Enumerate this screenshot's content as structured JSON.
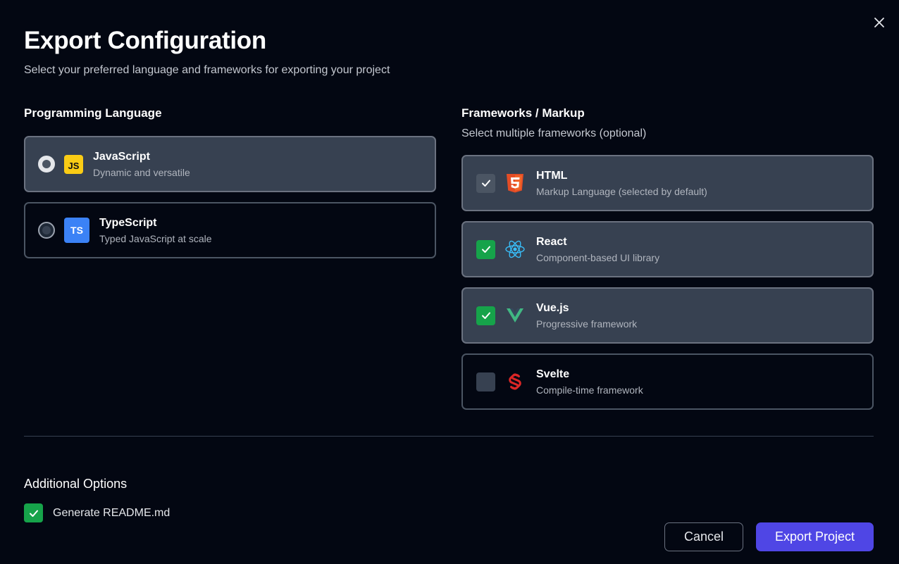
{
  "dialog": {
    "title": "Export Configuration",
    "subtitle": "Select your preferred language and frameworks for exporting your project"
  },
  "language_section": {
    "heading": "Programming Language",
    "options": [
      {
        "name": "JavaScript",
        "description": "Dynamic and versatile",
        "badge": "JS",
        "selected": true
      },
      {
        "name": "TypeScript",
        "description": "Typed JavaScript at scale",
        "badge": "TS",
        "selected": false
      }
    ]
  },
  "frameworks_section": {
    "heading": "Frameworks / Markup",
    "subheading": "Select multiple frameworks (optional)",
    "options": [
      {
        "name": "HTML",
        "description": "Markup Language (selected by default)",
        "icon": "html5-icon",
        "checked": true
      },
      {
        "name": "React",
        "description": "Component-based UI library",
        "icon": "react-icon",
        "checked": true
      },
      {
        "name": "Vue.js",
        "description": "Progressive framework",
        "icon": "vue-icon",
        "checked": true
      },
      {
        "name": "Svelte",
        "description": "Compile-time framework",
        "icon": "svelte-icon",
        "checked": false
      }
    ]
  },
  "additional_options": {
    "heading": "Additional Options",
    "items": [
      {
        "label": "Generate README.md",
        "checked": true
      }
    ]
  },
  "actions": {
    "cancel_label": "Cancel",
    "export_label": "Export Project"
  },
  "colors": {
    "background": "#030712",
    "accent": "#4f46e5",
    "check_green": "#16a34a",
    "js_yellow": "#facc15",
    "ts_blue": "#3b82f6",
    "html_orange": "#e44d26",
    "react_blue": "#38bdf8",
    "vue_green": "#41b883",
    "svelte_red": "#dc2626"
  }
}
